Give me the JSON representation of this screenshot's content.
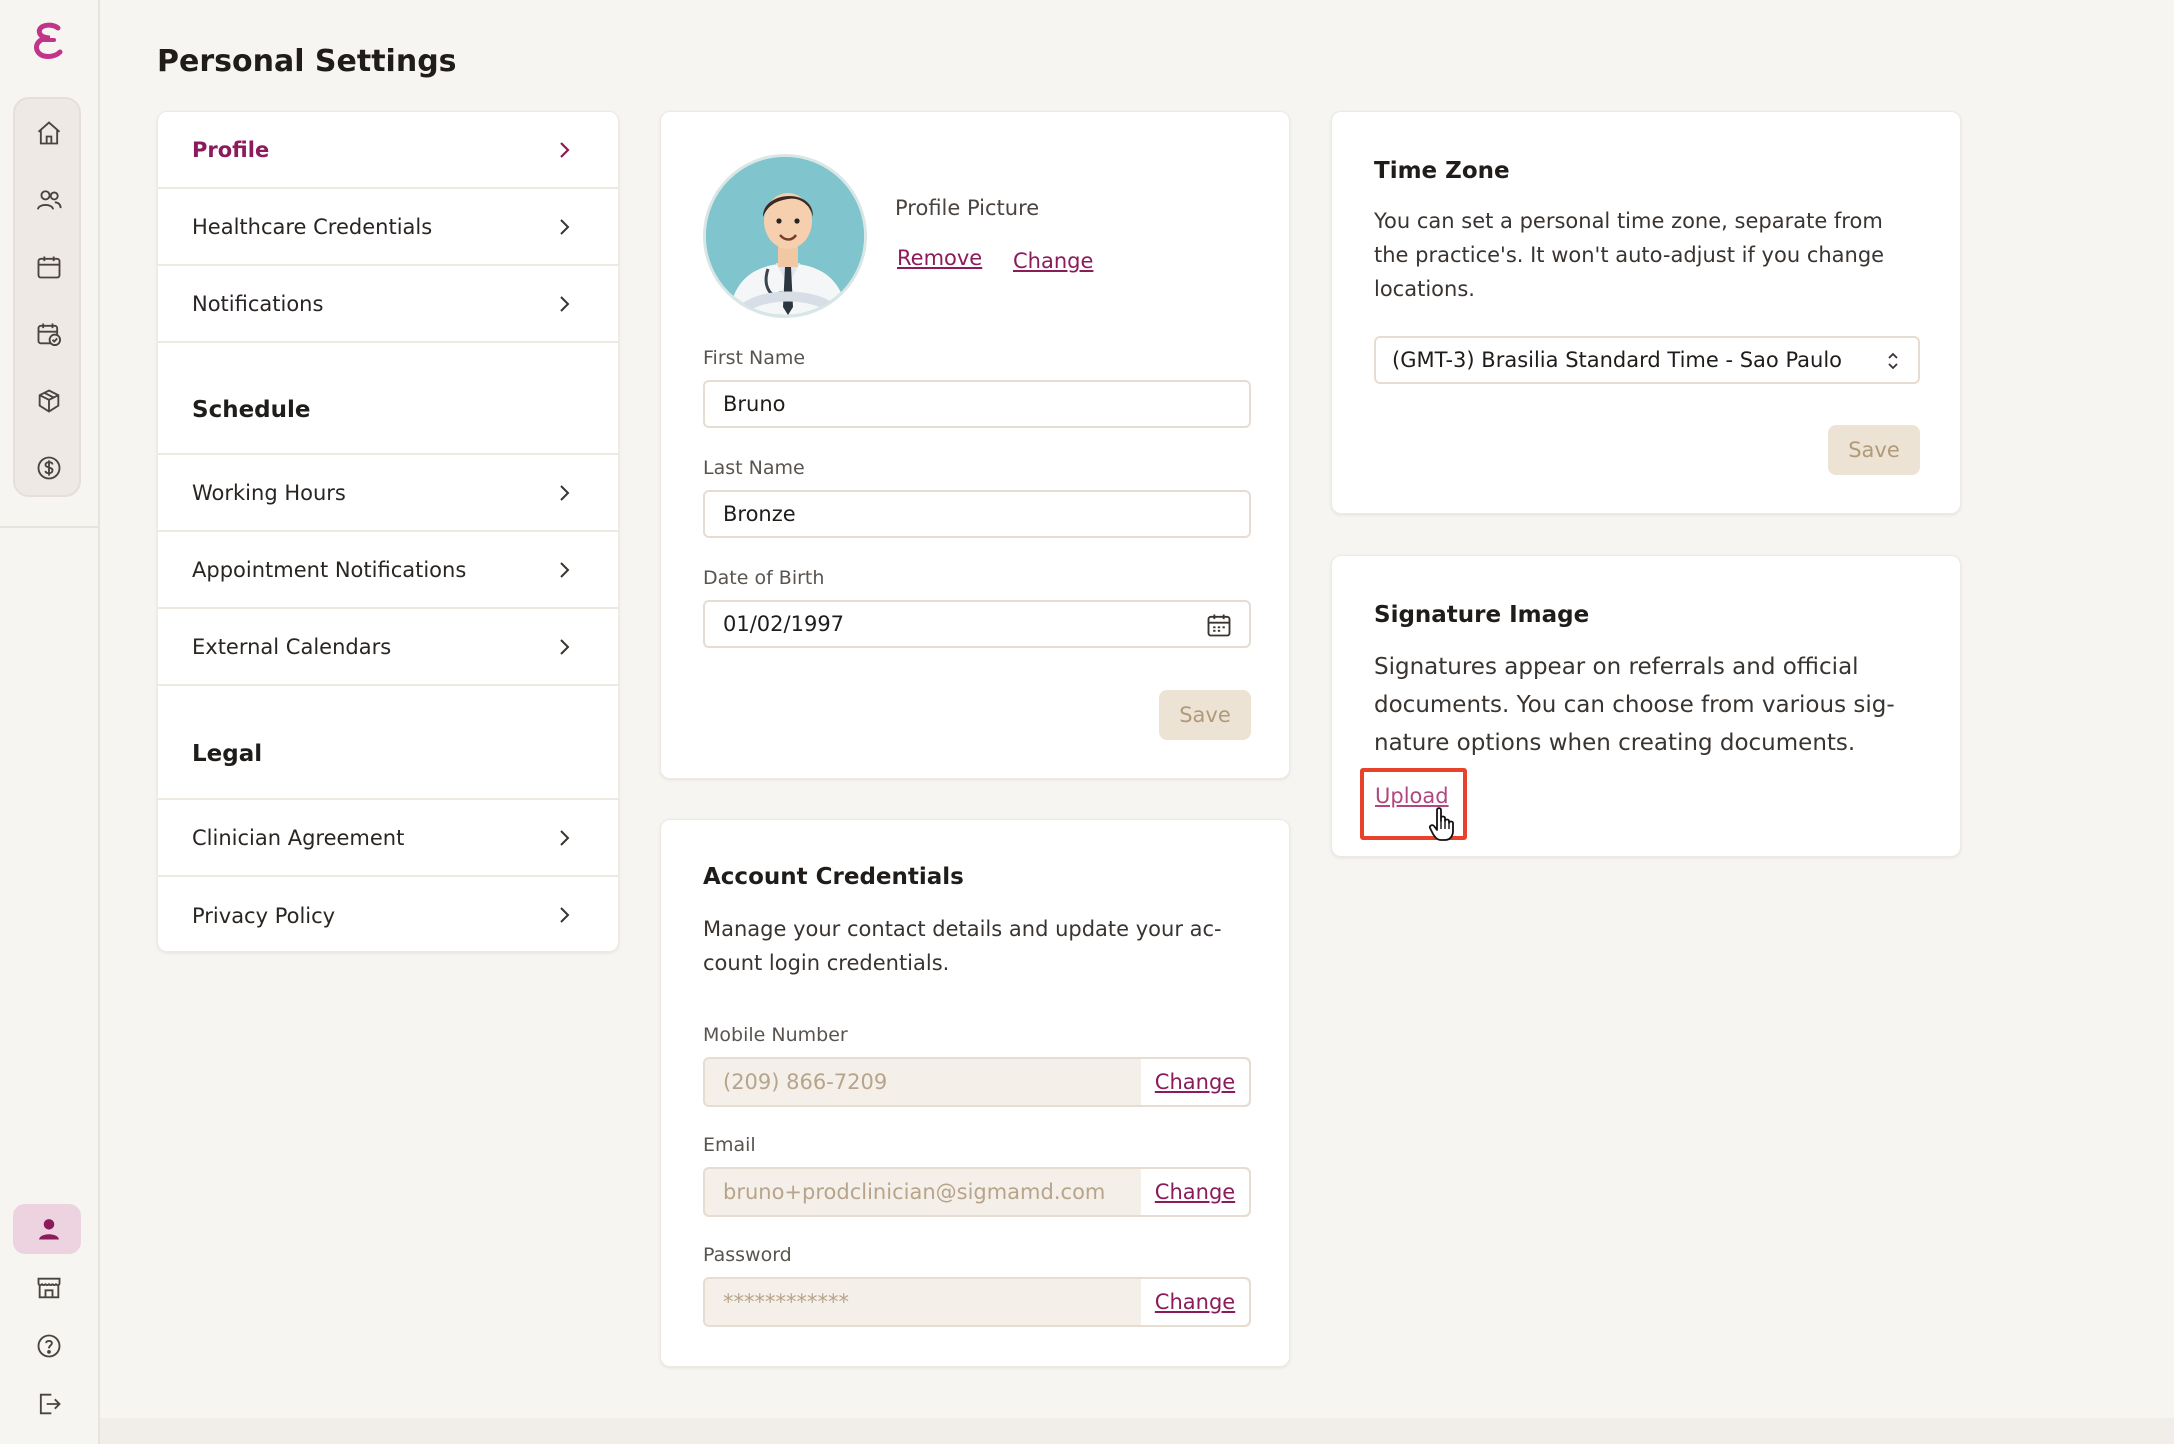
{
  "page": {
    "title": "Personal Settings"
  },
  "rail": {
    "top_icons": [
      "home-icon",
      "users-icon",
      "calendar-icon",
      "calendar-check-icon",
      "box-icon",
      "dollar-icon"
    ],
    "bottom_icons": [
      "profile-icon",
      "store-icon",
      "help-icon",
      "logout-icon"
    ],
    "accent": "#8b1b5a"
  },
  "nav": {
    "items": [
      {
        "label": "Profile"
      },
      {
        "label": "Healthcare Credentials"
      },
      {
        "label": "Notifications"
      }
    ],
    "schedule_heading": "Schedule",
    "schedule_items": [
      {
        "label": "Working Hours"
      },
      {
        "label": "Appointment Notifications"
      },
      {
        "label": "External Calendars"
      }
    ],
    "legal_heading": "Legal",
    "legal_items": [
      {
        "label": "Clinician Agreement"
      },
      {
        "label": "Privacy Policy"
      }
    ]
  },
  "profile": {
    "picture_label": "Profile Picture",
    "remove_label": "Remove",
    "change_label": "Change",
    "first_name_label": "First Name",
    "first_name": "Bruno",
    "last_name_label": "Last Name",
    "last_name": "Bronze",
    "dob_label": "Date of Birth",
    "dob": "01/02/1997",
    "save_label": "Save"
  },
  "account": {
    "title": "Account Credentials",
    "desc_line1": "Manage your contact details and update your ac-",
    "desc_line2": "count login credentials.",
    "mobile_label": "Mobile Number",
    "mobile": "(209) 866-7209",
    "email_label": "Email",
    "email": "bruno+prodclinician@sigmamd.com",
    "password_label": "Password",
    "password": "************",
    "change_label": "Change"
  },
  "timezone": {
    "title": "Time Zone",
    "desc_line1": "You can set a personal time zone, separate from",
    "desc_line2": "the practice's. It won't auto-adjust if you change",
    "desc_line3": "locations.",
    "selected": "(GMT-3) Brasilia Standard Time - Sao Paulo",
    "save_label": "Save"
  },
  "signature": {
    "title": "Signature Image",
    "desc_line1": "Signatures appear on referrals and official",
    "desc_line2": "documents. You can choose from various sig-",
    "desc_line3": "nature options when creating documents.",
    "upload_label": "Upload"
  }
}
